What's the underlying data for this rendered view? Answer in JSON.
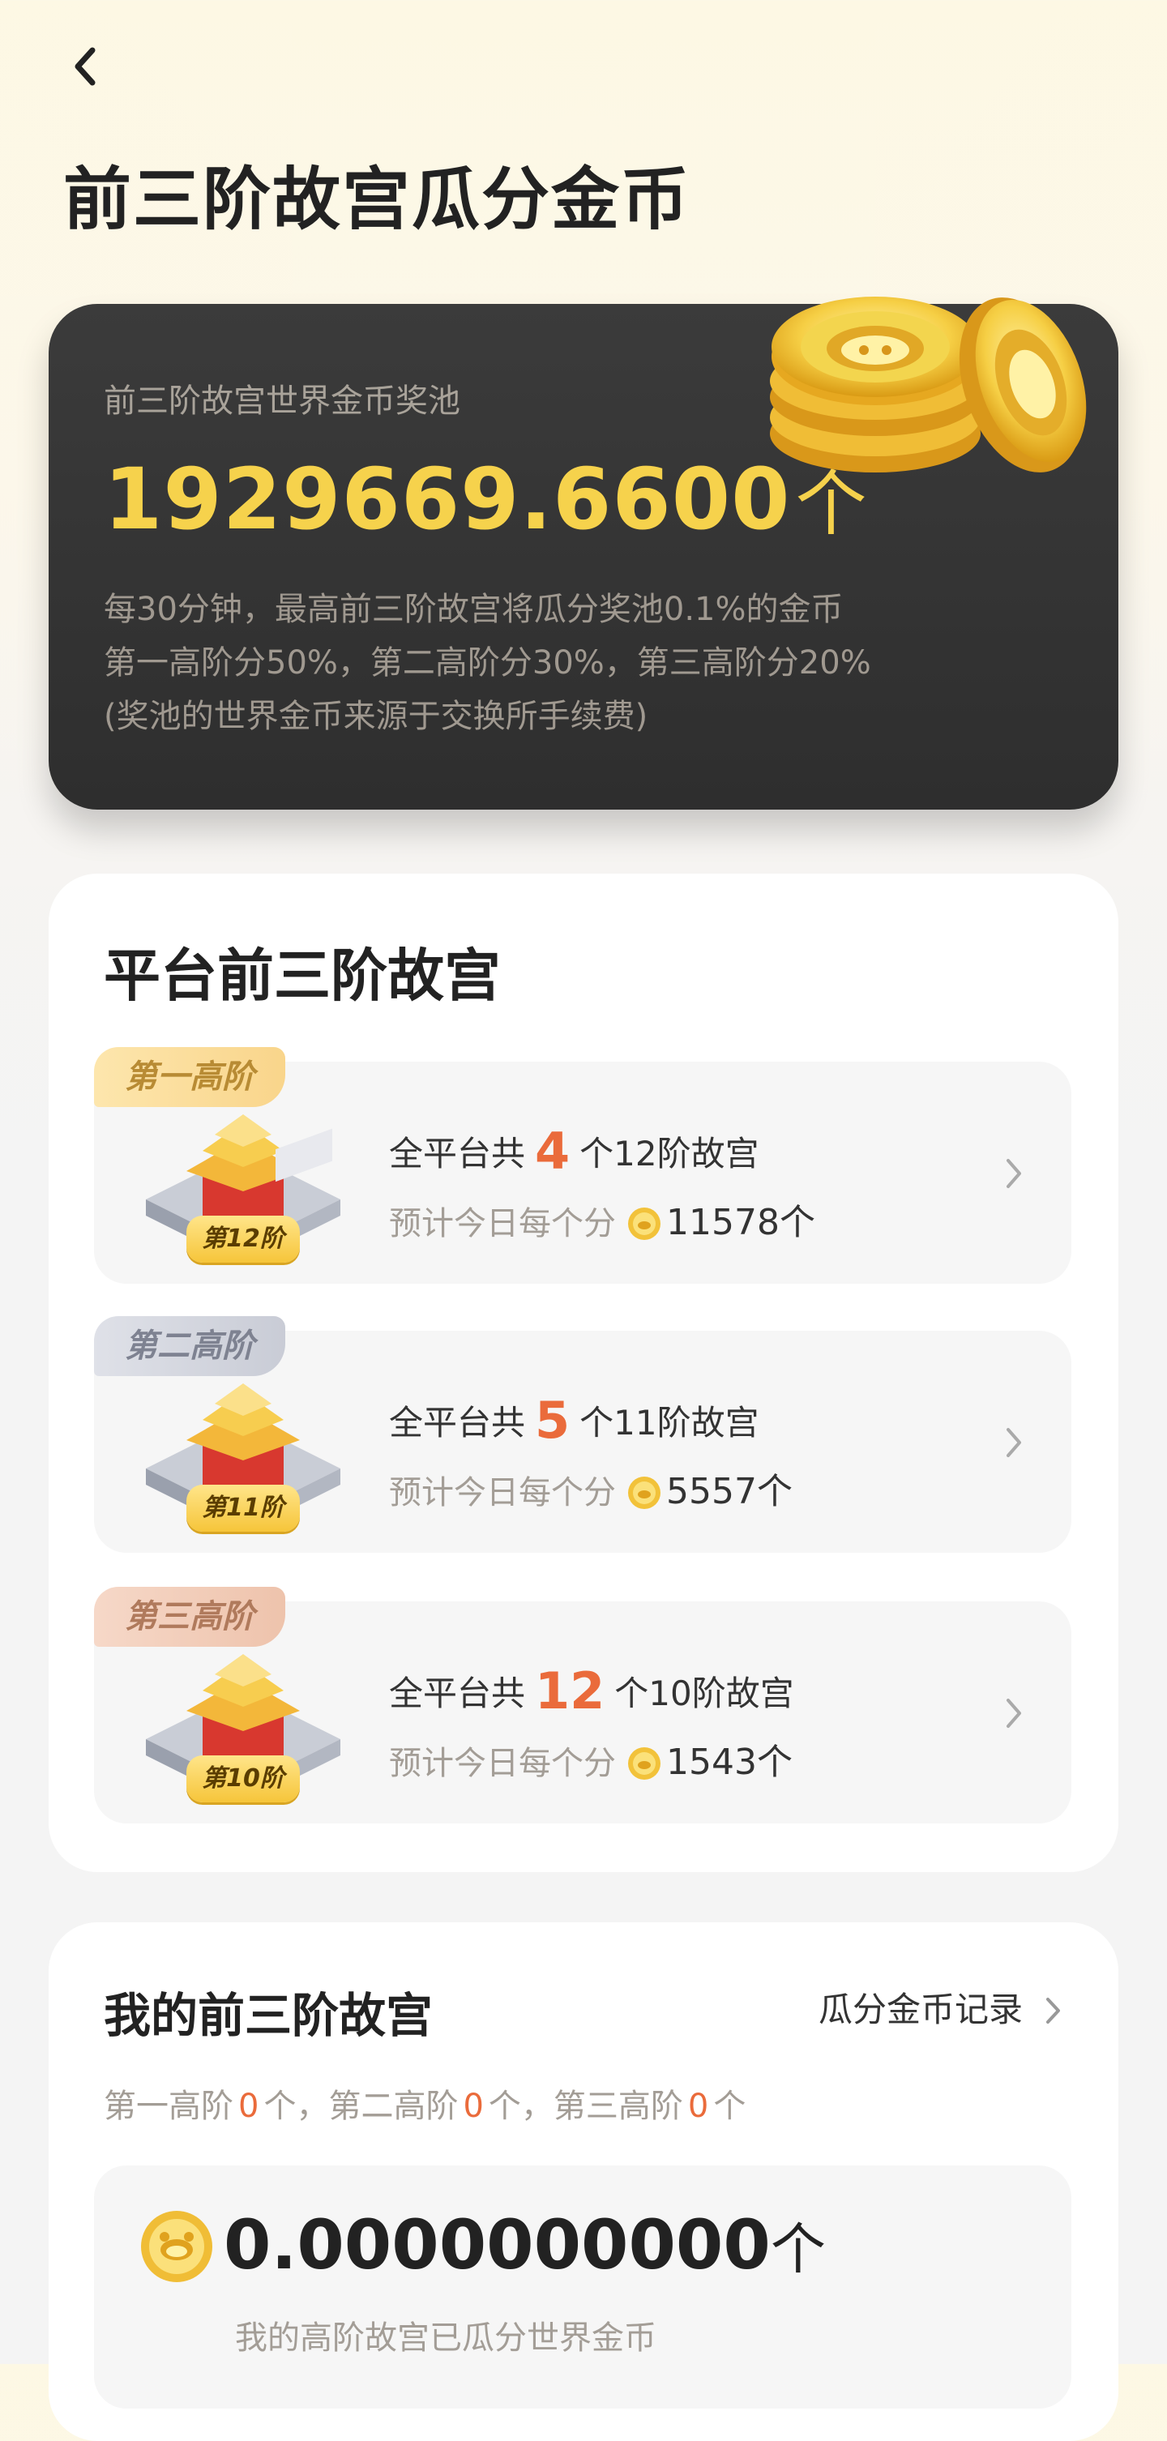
{
  "header": {
    "back_icon": "chevron-left-icon",
    "title": "前三阶故宫瓜分金币"
  },
  "pool": {
    "label": "前三阶故宫世界金币奖池",
    "amount": "1929669.6600",
    "unit": "个",
    "desc_lines": [
      "每30分钟，最高前三阶故宫将瓜分奖池0.1%的金币",
      "第一高阶分50%，第二高阶分30%，第三高阶分20%",
      "(奖池的世界金币来源于交换所手续费)"
    ],
    "accent_color": "#f6d24c"
  },
  "platform": {
    "title": "平台前三阶故宫",
    "tiers": [
      {
        "tag": "第一高阶",
        "level": "第12阶",
        "prefix": "全平台共",
        "count": "4",
        "suffix": "个12阶故宫",
        "share_label": "预计今日每个分",
        "share_value": "11578个"
      },
      {
        "tag": "第二高阶",
        "level": "第11阶",
        "prefix": "全平台共",
        "count": "5",
        "suffix": "个11阶故宫",
        "share_label": "预计今日每个分",
        "share_value": "5557个"
      },
      {
        "tag": "第三高阶",
        "level": "第10阶",
        "prefix": "全平台共",
        "count": "12",
        "suffix": "个10阶故宫",
        "share_label": "预计今日每个分",
        "share_value": "1543个"
      }
    ]
  },
  "mine": {
    "title": "我的前三阶故宫",
    "record_link": "瓜分金币记录",
    "summary": {
      "t1_label": "第一高阶",
      "t1_count": "0",
      "t1_unit": "个，",
      "t2_label": "第二高阶",
      "t2_count": "0",
      "t2_unit": "个，",
      "t3_label": "第三高阶",
      "t3_count": "0",
      "t3_unit": "个"
    },
    "amount": "0.0000000000",
    "unit": "个",
    "caption": "我的高阶故宫已瓜分世界金币"
  }
}
